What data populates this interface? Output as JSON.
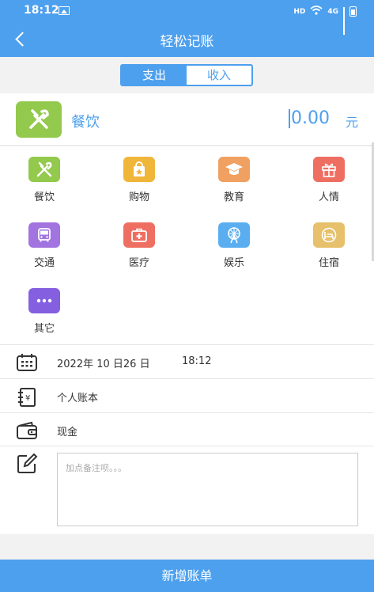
{
  "status": {
    "time": "18:12",
    "hd": "HD",
    "net": "4G"
  },
  "header": {
    "title": "轻松记账"
  },
  "tabs": {
    "expense": "支出",
    "income": "收入"
  },
  "selected": {
    "name": "餐饮",
    "amount": "0.00",
    "unit": "元"
  },
  "categories": [
    {
      "label": "餐饮",
      "icon": "utensils-icon",
      "color": "#93c94c"
    },
    {
      "label": "购物",
      "icon": "shopping-bag-icon",
      "color": "#f0b63a"
    },
    {
      "label": "教育",
      "icon": "graduation-cap-icon",
      "color": "#f0a060"
    },
    {
      "label": "人情",
      "icon": "gift-icon",
      "color": "#ee6f62"
    },
    {
      "label": "交通",
      "icon": "bus-icon",
      "color": "#a274e0"
    },
    {
      "label": "医疗",
      "icon": "medical-kit-icon",
      "color": "#ee6f62"
    },
    {
      "label": "娱乐",
      "icon": "ferris-wheel-icon",
      "color": "#5aaef0"
    },
    {
      "label": "住宿",
      "icon": "bed-icon",
      "color": "#e6c06a"
    },
    {
      "label": "其它",
      "icon": "more-icon",
      "color": "#8460e0"
    }
  ],
  "date": {
    "date_text": "2022年 10 日26 日",
    "time_text": "18:12"
  },
  "account_book": "个人账本",
  "payment": "现金",
  "note": {
    "placeholder": "加点备注呗。。。",
    "value": ""
  },
  "submit_label": "新增账单",
  "colors": {
    "primary": "#4da0ee",
    "food": "#93c94c"
  }
}
